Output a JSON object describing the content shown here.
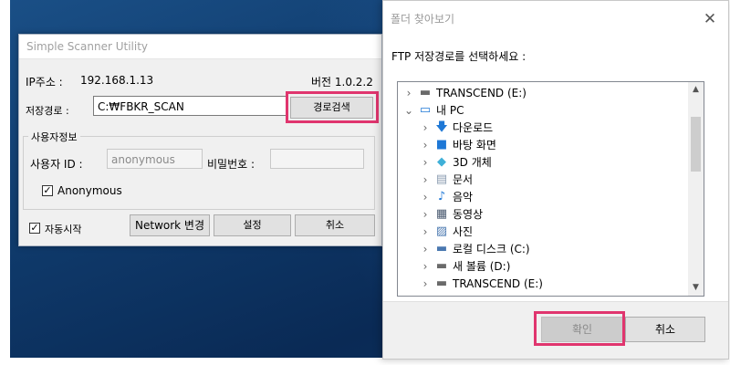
{
  "scanner_window": {
    "title": "Simple Scanner Utility",
    "ip_label": "IP주소 :",
    "ip_value": "192.168.1.13",
    "version_text": "버전 1.0.2.2",
    "path_label": "저장경로 :",
    "path_value": "C:₩FBKR_SCAN",
    "browse_path_button": "경로검색",
    "user_group_title": "사용자정보",
    "user_id_label": "사용자 ID :",
    "user_id_value": "anonymous",
    "password_label": "비밀번호 :",
    "password_value": "",
    "anonymous_label": "Anonymous",
    "anonymous_checked": true,
    "autostart_label": "자동시작",
    "autostart_checked": true,
    "network_button": "Network 변경",
    "settings_button": "설정",
    "cancel_button": "취소"
  },
  "folder_dialog": {
    "title": "폴더 찾아보기",
    "close_glyph": "✕",
    "instruction": "FTP 저장경로를 선택하세요 :",
    "tree_items": [
      {
        "label": "TRANSCEND (E:)",
        "icon": "drive-icon",
        "expander": "›"
      },
      {
        "label": "내 PC",
        "icon": "computer-icon",
        "expander": "⌄"
      },
      {
        "label": "다운로드",
        "icon": "download-icon",
        "expander": "›"
      },
      {
        "label": "바탕 화면",
        "icon": "desktop-icon",
        "expander": "›"
      },
      {
        "label": "3D 개체",
        "icon": "3d-objects-icon",
        "expander": "›"
      },
      {
        "label": "문서",
        "icon": "document-icon",
        "expander": "›"
      },
      {
        "label": "음악",
        "icon": "music-icon",
        "expander": "›"
      },
      {
        "label": "동영상",
        "icon": "video-icon",
        "expander": "›"
      },
      {
        "label": "사진",
        "icon": "picture-icon",
        "expander": "›"
      },
      {
        "label": "로컬 디스크 (C:)",
        "icon": "local-disk-icon",
        "expander": "›"
      },
      {
        "label": "새 볼륨 (D:)",
        "icon": "drive-icon",
        "expander": "›"
      },
      {
        "label": "TRANSCEND (E:)",
        "icon": "drive-icon",
        "expander": "›"
      }
    ],
    "ok_button": "확인",
    "cancel_button": "취소"
  },
  "colors": {
    "highlight": "#e0356e",
    "desktop": "#0f3a6b",
    "folder_blue": "#1e78d6"
  }
}
